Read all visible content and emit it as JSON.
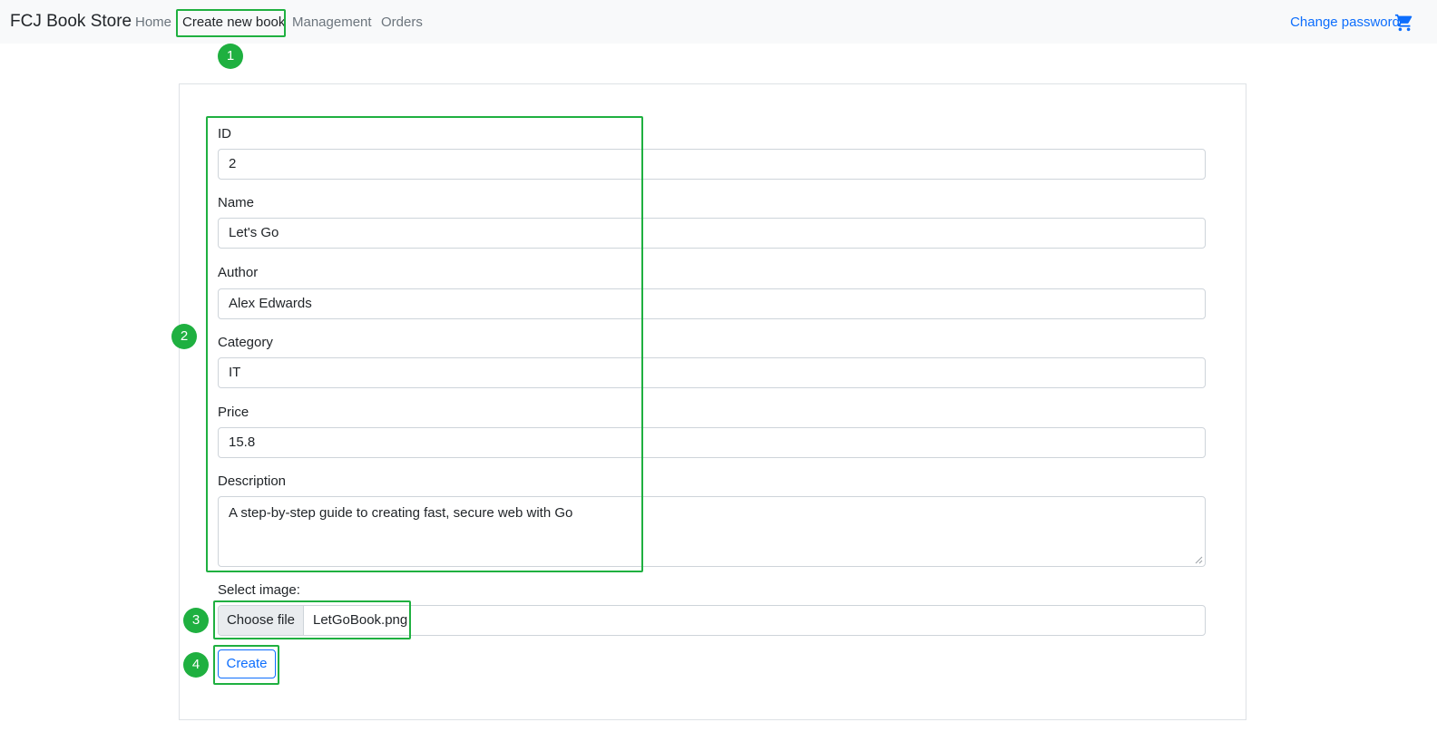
{
  "navbar": {
    "brand": "FCJ Book Store",
    "links": [
      {
        "label": "Home"
      },
      {
        "label": "Create new book"
      },
      {
        "label": "Management"
      },
      {
        "label": "Orders"
      }
    ],
    "change_password": "Change password",
    "cart_icon": "cart-icon"
  },
  "form": {
    "id_label": "ID",
    "id_value": "2",
    "name_label": "Name",
    "name_value": "Let's Go",
    "author_label": "Author",
    "author_value": "Alex Edwards",
    "category_label": "Category",
    "category_value": "IT",
    "price_label": "Price",
    "price_value": "15.8",
    "description_label": "Description",
    "description_value": "A step-by-step guide to creating fast, secure web with Go",
    "image_label": "Select image:",
    "choose_file": "Choose file",
    "file_name": "LetGoBook.png",
    "create": "Create"
  },
  "annotations": {
    "badge1": "1",
    "badge2": "2",
    "badge3": "3",
    "badge4": "4"
  },
  "colors": {
    "highlight": "#1fb040",
    "link": "#0d6efd",
    "navbar_bg": "#f8f9fa"
  }
}
